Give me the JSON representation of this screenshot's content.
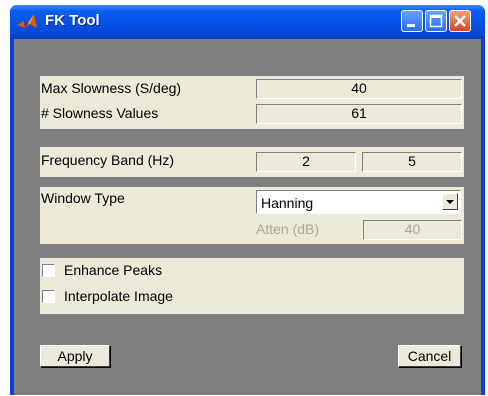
{
  "window": {
    "title": "FK Tool",
    "icon": "matlab-icon",
    "controls": [
      "minimize-icon",
      "maximize-icon",
      "close-icon"
    ]
  },
  "slowness": {
    "max_label": "Max Slowness (S/deg)",
    "max_value": "40",
    "count_label": "# Slowness Values",
    "count_value": "61"
  },
  "frequency": {
    "label": "Frequency Band (Hz)",
    "low": "2",
    "high": "5"
  },
  "window_type": {
    "label": "Window Type",
    "selected": "Hanning",
    "atten_label": "Atten (dB)",
    "atten_value": "40"
  },
  "options": {
    "enhance_label": "Enhance Peaks",
    "interpolate_label": "Interpolate Image"
  },
  "buttons": {
    "apply": "Apply",
    "cancel": "Cancel"
  },
  "colors": {
    "titlebar": "#0a5ef0",
    "panel": "#ece9d8",
    "client": "#7f7f7f"
  }
}
